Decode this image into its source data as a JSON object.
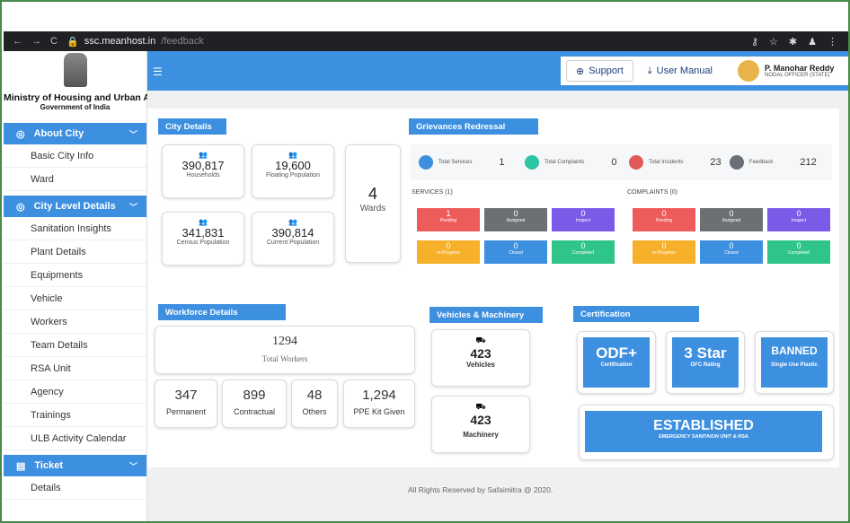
{
  "browser": {
    "host": "ssc.meanhost.in",
    "path": "/feedback"
  },
  "sidebar": {
    "ministry": "Ministry of Housing and Urban Affairs",
    "govt": "Government of India",
    "sections": [
      {
        "label": "About City",
        "items": [
          "Basic City Info",
          "Ward"
        ]
      },
      {
        "label": "City Level Details",
        "items": [
          "Sanitation Insights",
          "Plant Details",
          "Equipments",
          "Vehicle",
          "Workers",
          "Team Details",
          "RSA Unit",
          "Agency",
          "Trainings",
          "ULB Activity Calendar"
        ]
      },
      {
        "label": "Ticket",
        "items": [
          "Details"
        ]
      }
    ]
  },
  "topbar": {
    "support": "Support",
    "manual": "User Manual",
    "user_name": "P. Manohar Reddy",
    "user_role": "NODAL OFFICER (STATE)"
  },
  "city": {
    "title": "City Details",
    "households": {
      "value": "390,817",
      "label": "Households"
    },
    "floating": {
      "value": "19,600",
      "label": "Floating Population"
    },
    "census": {
      "value": "341,831",
      "label": "Census Population"
    },
    "current": {
      "value": "390,814",
      "label": "Current Population"
    },
    "wards": {
      "value": "4",
      "label": "Wards"
    }
  },
  "grievances": {
    "title": "Grievances Redressal",
    "items": [
      {
        "label": "Total Services",
        "value": "1",
        "color": "#3d8fe0"
      },
      {
        "label": "Total Complaints",
        "value": "0",
        "color": "#2ec4a6"
      },
      {
        "label": "Total Incidents",
        "value": "23",
        "color": "#e05a5a"
      },
      {
        "label": "Feedback",
        "value": "212",
        "color": "#6a6f75"
      }
    ],
    "services_label": "SERVICES (1)",
    "complaints_label": "COMPLAINTS (0)",
    "services": [
      {
        "v": "1",
        "l": "Pending",
        "c": "#ee5b5b"
      },
      {
        "v": "0",
        "l": "Assigned",
        "c": "#6b7075"
      },
      {
        "v": "0",
        "l": "Inspect",
        "c": "#7a5be8"
      },
      {
        "v": "0",
        "l": "In-Progress",
        "c": "#f6b02a"
      },
      {
        "v": "0",
        "l": "Closed",
        "c": "#3d8fe0"
      },
      {
        "v": "0",
        "l": "Completed",
        "c": "#2ec48a"
      }
    ],
    "complaints": [
      {
        "v": "0",
        "l": "Pending",
        "c": "#ee5b5b"
      },
      {
        "v": "0",
        "l": "Assigned",
        "c": "#6b7075"
      },
      {
        "v": "0",
        "l": "Inspect",
        "c": "#7a5be8"
      },
      {
        "v": "0",
        "l": "In-Progress",
        "c": "#f6b02a"
      },
      {
        "v": "0",
        "l": "Closed",
        "c": "#3d8fe0"
      },
      {
        "v": "0",
        "l": "Completed",
        "c": "#2ec48a"
      }
    ]
  },
  "workforce": {
    "title": "Workforce Details",
    "total": "1294",
    "total_label": "Total Workers",
    "permanent": "347",
    "permanent_label": "Permanent",
    "contractual": "899",
    "contractual_label": "Contractual",
    "others": "48",
    "others_label": "Others",
    "ppe": "1,294",
    "ppe_label": "PPE Kit Given"
  },
  "vehicles": {
    "title": "Vehicles & Machinery",
    "vehicles": "423",
    "vehicles_label": "Vehicles",
    "machinery": "423",
    "machinery_label": "Machinery"
  },
  "certification": {
    "title": "Certification",
    "odf": "ODF+",
    "odf_label": "Certification",
    "star": "3 Star",
    "star_label": "GFC Rating",
    "banned": "BANNED",
    "banned_label": "Single Use Plastic",
    "established": "ESTABLISHED",
    "established_label": "EMERGENCY SANITAION UNIT & RSA"
  },
  "footer": "All Rights Reserved by Safaimitra @ 2020."
}
